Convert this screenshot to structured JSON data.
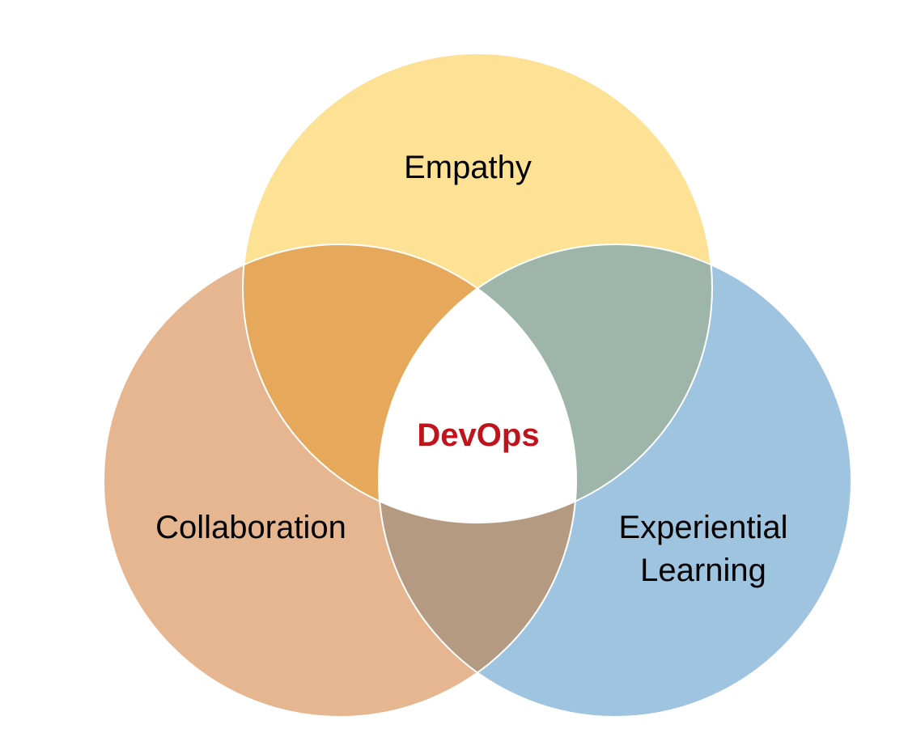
{
  "diagram": {
    "circles": {
      "empathy": {
        "label": "Empathy",
        "color": "#fde295"
      },
      "collaboration": {
        "label": "Collaboration",
        "color": "#e6b690"
      },
      "experiential_learning": {
        "label_line1": "Experiential",
        "label_line2": "Learning",
        "color": "#9fc4e0"
      }
    },
    "overlaps": {
      "empathy_collaboration": "#e6a95c",
      "empathy_learning": "#9eb5a9",
      "collaboration_learning": "#b59a82"
    },
    "center": {
      "label": "DevOps",
      "label_color": "#c0141c",
      "fill": "#ffffff"
    }
  }
}
